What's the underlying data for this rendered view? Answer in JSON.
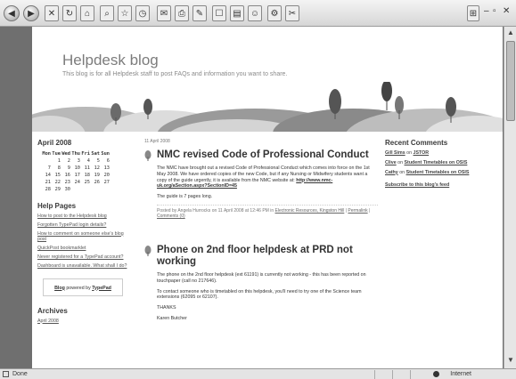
{
  "browser": {
    "status_text": "Done",
    "zone_text": "Internet"
  },
  "blog": {
    "title": "Helpdesk blog",
    "description": "This blog is for all Helpdesk staff to post FAQs and information you want to share."
  },
  "calendar": {
    "heading": "April 2008",
    "days": [
      "Mon",
      "Tue",
      "Wed",
      "Thu",
      "Fri",
      "Sat",
      "Sun"
    ],
    "weeks": [
      [
        "",
        "1",
        "2",
        "3",
        "4",
        "5",
        "6"
      ],
      [
        "7",
        "8",
        "9",
        "10",
        "11",
        "12",
        "13"
      ],
      [
        "14",
        "15",
        "16",
        "17",
        "18",
        "19",
        "20"
      ],
      [
        "21",
        "22",
        "23",
        "24",
        "25",
        "26",
        "27"
      ],
      [
        "28",
        "29",
        "30",
        "",
        "",
        "",
        ""
      ]
    ]
  },
  "help_pages": {
    "heading": "Help Pages",
    "items": [
      "How to post to the Helpdesk blog",
      "Forgotten TypePad login details?",
      "How to comment on someone else's blog post",
      "QuickPost bookmarklet",
      "Never registered for a TypePad account?",
      "Dashboard is unavailable. What shall I do?"
    ]
  },
  "powered": {
    "prefix": "Blog",
    "middle": " powered by ",
    "brand": "TypePad"
  },
  "archives": {
    "heading": "Archives",
    "first_item": "April 2008"
  },
  "main": {
    "date": "11 April 2008",
    "post1": {
      "title": "NMC revised Code of Professional Conduct",
      "body": "The NMC have brought out a revised Code of Professional Conduct which comes into force on the 1st May 2008. We have ordered copies of the new Code, but if any Nursing or Midwifery students want a copy of the guide urgently, it is available from the NMC website at:",
      "link": "http://www.nmc-uk.org/aSection.aspx?SectionID=45",
      "body2": "The guide is 7 pages long.",
      "meta_prefix": "Posted by Angela Hurrocks on 11 April 2008 at 12:46 PM in ",
      "meta_cat": "Electronic Resources, Kingston Hill",
      "meta_sep": " | ",
      "meta_perma": "Permalink",
      "meta_comments": "Comments (0)"
    },
    "post2": {
      "title": "Phone on 2nd floor helpdesk at PRD not working",
      "body": "The phone on the 2nd floor helpdesk (ext 61191) is currently not working - this has been reported on touchpaper (call no 217646).",
      "body2": "To contact someone who is timetabled on this helpdesk, you'll need to try one of the Science team extensions (62095 or 62107).",
      "body3": "THANKS",
      "body4": "Karen Butcher"
    }
  },
  "recent_comments": {
    "heading": "Recent Comments",
    "items": [
      {
        "author": "Gill Sims",
        "on": " on ",
        "post": "JSTOR"
      },
      {
        "author": "Clive",
        "on": " on ",
        "post": "Student Timetables on OSIS"
      },
      {
        "author": "Cathy",
        "on": " on ",
        "post": "Student Timetables on OSIS"
      }
    ],
    "subscribe": "Subscribe to this blog's feed"
  },
  "colors": {
    "hill_light": "#d0d0d0",
    "hill_mid": "#a8a8a8",
    "hill_dark": "#555555"
  }
}
